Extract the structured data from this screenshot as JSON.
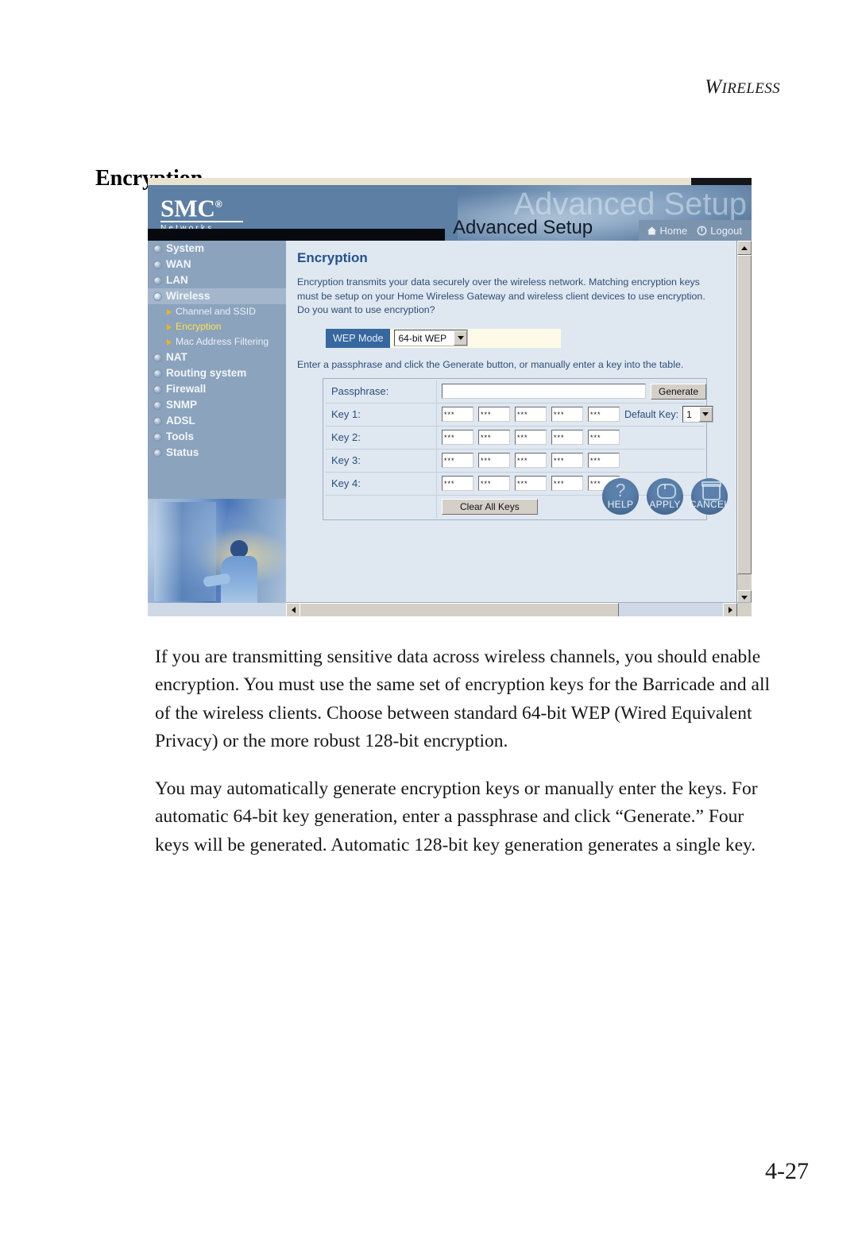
{
  "document": {
    "running_header": "WIRELESS",
    "running_header_cap": "W",
    "running_header_rest": "IRELESS",
    "section_title": "Encryption",
    "page_number": "4-27",
    "paragraphs": [
      "If you are transmitting sensitive data across wireless channels, you should enable encryption. You must use the same set of encryption keys for the Barricade and all of the wireless clients. Choose between standard 64-bit WEP (Wired Equivalent Privacy) or the more robust 128-bit encryption.",
      "You may automatically generate encryption keys or manually enter the keys. For automatic 64-bit key generation, enter a passphrase and click “Generate.” Four keys will be generated. Automatic 128-bit key generation generates a single key."
    ]
  },
  "screenshot": {
    "banner": {
      "logo_main": "SMC",
      "logo_registered": "®",
      "logo_sub": "Networks",
      "ghost_title": "Advanced Setup",
      "title": "Advanced Setup",
      "actions": [
        {
          "label": "Home",
          "icon": "home-icon"
        },
        {
          "label": "Logout",
          "icon": "logout-icon"
        }
      ]
    },
    "sidebar": {
      "items": [
        {
          "label": "System",
          "active": false
        },
        {
          "label": "WAN",
          "active": false
        },
        {
          "label": "LAN",
          "active": false
        },
        {
          "label": "Wireless",
          "active": true
        },
        {
          "label": "NAT",
          "active": false
        },
        {
          "label": "Routing system",
          "active": false
        },
        {
          "label": "Firewall",
          "active": false
        },
        {
          "label": "SNMP",
          "active": false
        },
        {
          "label": "ADSL",
          "active": false
        },
        {
          "label": "Tools",
          "active": false
        },
        {
          "label": "Status",
          "active": false
        }
      ],
      "subitems": [
        {
          "label": "Channel and SSID",
          "active": false
        },
        {
          "label": "Encryption",
          "active": true
        },
        {
          "label": "Mac Address Filtering",
          "active": false
        }
      ]
    },
    "content": {
      "heading": "Encryption",
      "description": "Encryption transmits your data securely over the wireless network. Matching encryption keys must be setup on your Home Wireless Gateway and wireless client devices to use encryption. Do you want to use encryption?",
      "wep_mode_label": "WEP Mode",
      "wep_mode_value": "64-bit WEP",
      "hint": "Enter a passphrase and click the Generate button, or manually enter a key into the table.",
      "table": {
        "passphrase_label": "Passphrase:",
        "passphrase_value": "",
        "passphrase_placeholder": "",
        "generate_label": "Generate",
        "default_key_label": "Default Key:",
        "default_key_value": "1",
        "clear_all_label": "Clear All Keys",
        "keys": [
          {
            "label": "Key 1:",
            "fields": [
              "***",
              "***",
              "***",
              "***",
              "***"
            ]
          },
          {
            "label": "Key 2:",
            "fields": [
              "***",
              "***",
              "***",
              "***",
              "***"
            ]
          },
          {
            "label": "Key 3:",
            "fields": [
              "***",
              "***",
              "***",
              "***",
              "***"
            ]
          },
          {
            "label": "Key 4:",
            "fields": [
              "***",
              "***",
              "***",
              "***",
              "***"
            ]
          }
        ]
      }
    },
    "actions": [
      {
        "label": "HELP",
        "icon": "question-mark-icon"
      },
      {
        "label": "APPLY",
        "icon": "mouse-icon"
      },
      {
        "label": "CANCEL",
        "icon": "trash-can-icon"
      }
    ],
    "colors": {
      "banner_blue": "#5d7fa4",
      "sidebar_blue": "#8ca3bd",
      "content_bg": "#dfe7f1",
      "heading_blue": "#23528f",
      "wep_label_blue": "#36679f",
      "wep_field_cream": "#fdfbe8",
      "accent_yellow": "#ffe24a",
      "arrow_orange": "#f0b41e"
    }
  }
}
